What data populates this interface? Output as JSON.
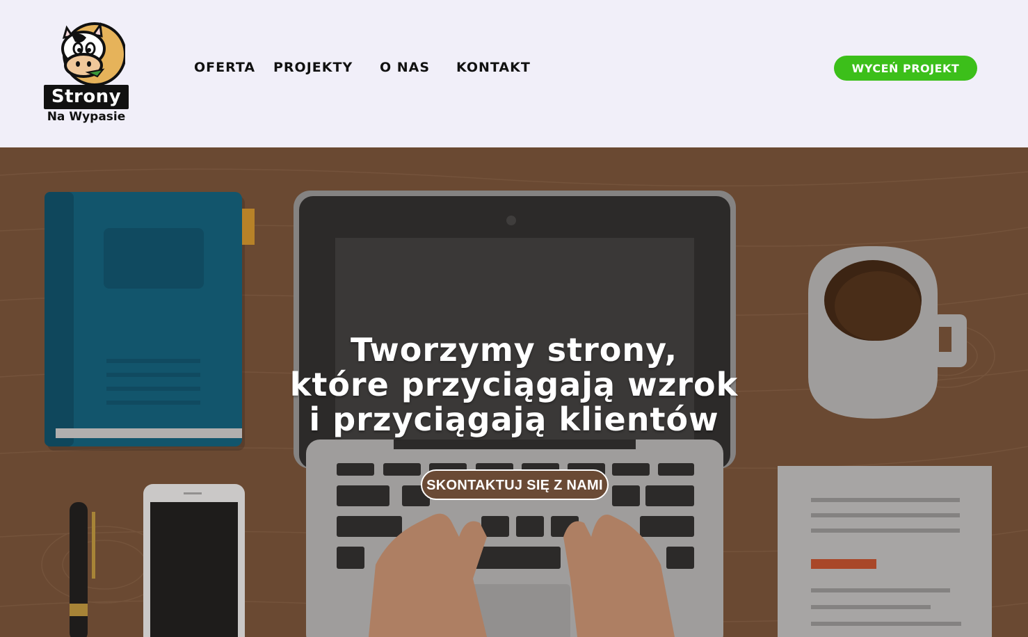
{
  "logo": {
    "title": "Strony",
    "subtitle": "Na Wypasie"
  },
  "nav": {
    "items": [
      {
        "label": "OFERTA"
      },
      {
        "label": "PROJEKTY"
      },
      {
        "label": "O NAS"
      },
      {
        "label": "KONTAKT"
      }
    ]
  },
  "header": {
    "cta_label": "WYCEŃ PROJEKT"
  },
  "hero": {
    "headline_lines": [
      "Tworzymy strony,",
      "które przyciągają wzrok",
      "i przyciągają klientów"
    ],
    "cta_label": "SKONTAKTUJ SIĘ Z NAMI"
  },
  "colors": {
    "background": "#f1eff9",
    "accent_green": "#3cbf1a",
    "hero_wood": "#6e4d35",
    "hero_button": "#6a4a35"
  }
}
